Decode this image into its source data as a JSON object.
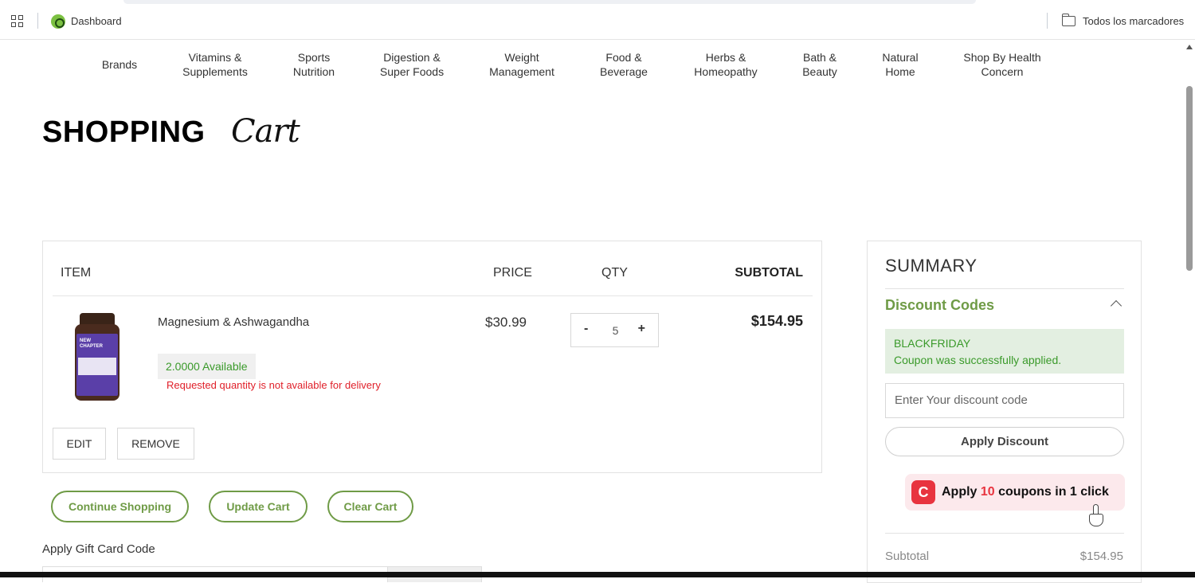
{
  "bookmarks": {
    "dashboard_label": "Dashboard",
    "all_bookmarks_label": "Todos los marcadores"
  },
  "nav": {
    "items": [
      "Brands",
      "Vitamins &\nSupplements",
      "Sports\nNutrition",
      "Digestion &\nSuper Foods",
      "Weight\nManagement",
      "Food &\nBeverage",
      "Herbs &\nHomeopathy",
      "Bath &\nBeauty",
      "Natural\nHome",
      "Shop By Health\nConcern"
    ]
  },
  "page": {
    "title_bold": "SHOPPING",
    "title_script": "Cart"
  },
  "cart": {
    "headers": {
      "item": "ITEM",
      "price": "PRICE",
      "qty": "QTY",
      "subtotal": "SUBTOTAL"
    },
    "item": {
      "bottle_label": "NEW CHAPTER",
      "name": "Magnesium & Ashwagandha",
      "availability": "2.0000 Available",
      "warning": "Requested quantity is not available for delivery",
      "price": "$30.99",
      "qty_minus": "-",
      "quantity": "5",
      "qty_plus": "+",
      "subtotal": "$154.95"
    },
    "edit_label": "EDIT",
    "remove_label": "REMOVE"
  },
  "actions": {
    "continue_label": "Continue Shopping",
    "update_label": "Update Cart",
    "clear_label": "Clear Cart"
  },
  "gift_card": {
    "label": "Apply Gift Card Code"
  },
  "summary": {
    "title": "SUMMARY",
    "discount_title": "Discount Codes",
    "applied_code": "BLACKFRIDAY",
    "applied_message": "Coupon was successfully applied.",
    "discount_placeholder": "Enter Your discount code",
    "apply_label": "Apply Discount",
    "coupon_logo": "C",
    "coupon_pre": "Apply ",
    "coupon_count": "10",
    "coupon_post": " coupons in 1 click",
    "subtotal_label": "Subtotal",
    "subtotal_value": "$154.95"
  },
  "colors": {
    "accent_green": "#6f9b46",
    "success_green": "#3a9a2a",
    "error_red": "#e0202a",
    "coupon_red": "#e8343f"
  }
}
